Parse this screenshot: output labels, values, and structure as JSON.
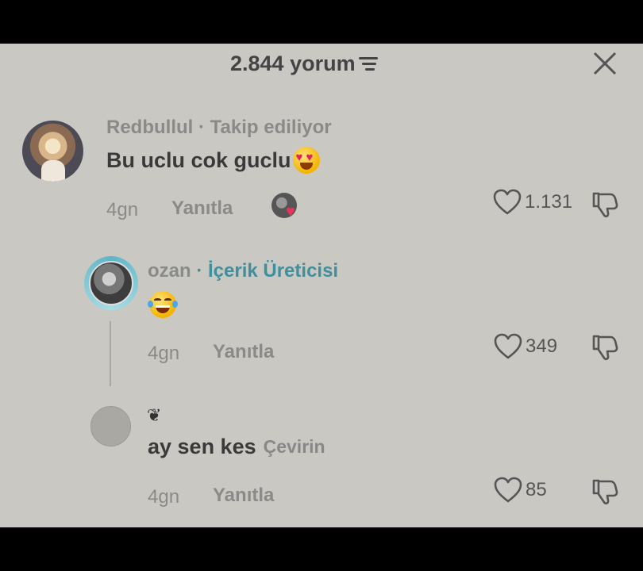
{
  "header": {
    "title": "2.844 yorum"
  },
  "comments": [
    {
      "username": "Redbullul",
      "separator": " · ",
      "tag": "Takip ediliyor",
      "text": "Bu uclu cok guclu",
      "time": "4gn",
      "reply_label": "Yanıtla",
      "likes": "1.131"
    },
    {
      "username": "ozan",
      "separator": " · ",
      "tag": "İçerik Üreticisi",
      "time": "4gn",
      "reply_label": "Yanıtla",
      "likes": "349"
    },
    {
      "username_icon": "❦",
      "text": "ay sen kes",
      "translate_label": "Çevirin",
      "time": "4gn",
      "reply_label": "Yanıtla",
      "likes": "85"
    }
  ],
  "colors": {
    "background": "#c9c8c3",
    "creator_tag": "#3f8f9c",
    "heart_red": "#e8345d"
  }
}
